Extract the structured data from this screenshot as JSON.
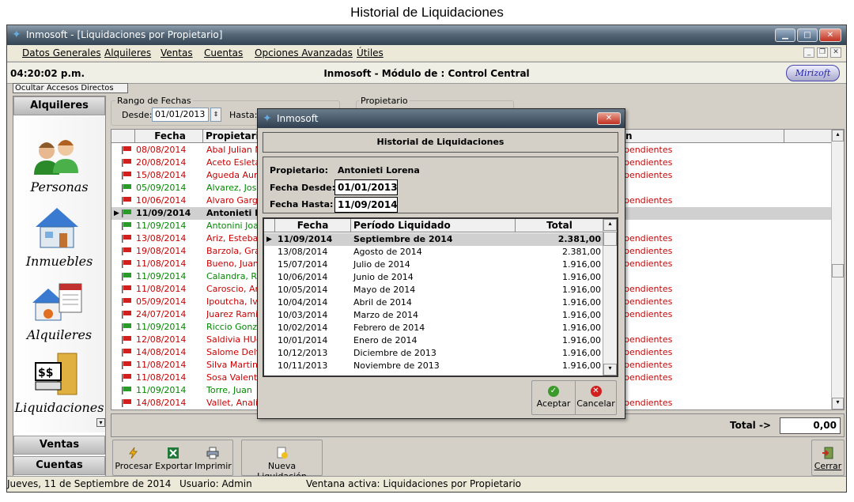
{
  "caption": "Historial de Liquidaciones",
  "window": {
    "title": "Inmosoft - [Liquidaciones por Propietario]"
  },
  "menu": [
    "Datos Generales",
    "Alquileres",
    "Ventas",
    "Cuentas",
    "Opciones Avanzadas",
    "Útiles"
  ],
  "header": {
    "clock": "04:20:02 p.m.",
    "module_title": "Inmosoft - Módulo de : Control Central",
    "logo": "Mirizoft"
  },
  "ocultar_label": "Ocultar Accesos Directos",
  "sidebar": {
    "top_header": "Alquileres",
    "items": [
      {
        "label": "Personas"
      },
      {
        "label": "Inmuebles"
      },
      {
        "label": "Alquileres"
      },
      {
        "label": "Liquidaciones"
      }
    ],
    "bottom": [
      "Ventas",
      "Cuentas"
    ]
  },
  "filters": {
    "rango_label": "Rango de Fechas",
    "desde_label": "Desde:",
    "desde_value": "01/01/2013",
    "hasta_label": "Hasta:",
    "propietario_label": "Propietario"
  },
  "grid": {
    "columns": [
      "Fecha",
      "Propietario"
    ],
    "col3_fragment": "n",
    "rows": [
      {
        "fecha": "08/08/2014",
        "prop": "Abal Julian Nic",
        "status": "red",
        "extra": "pendientes"
      },
      {
        "fecha": "20/08/2014",
        "prop": "Aceto Esleta",
        "status": "red",
        "extra": "pendientes"
      },
      {
        "fecha": "15/08/2014",
        "prop": "Agueda Auron",
        "status": "red",
        "extra": "pendientes"
      },
      {
        "fecha": "05/09/2014",
        "prop": "Alvarez, Jose",
        "status": "green",
        "extra": ""
      },
      {
        "fecha": "10/06/2014",
        "prop": "Alvaro Gargar",
        "status": "red",
        "extra": "pendientes"
      },
      {
        "fecha": "11/09/2014",
        "prop": "Antonieti  L",
        "status": "selected",
        "extra": ""
      },
      {
        "fecha": "11/09/2014",
        "prop": "Antonini Joaq",
        "status": "green",
        "extra": ""
      },
      {
        "fecha": "13/08/2014",
        "prop": "Ariz, Esteban",
        "status": "red",
        "extra": "pendientes"
      },
      {
        "fecha": "19/08/2014",
        "prop": "Barzola, Grac",
        "status": "red",
        "extra": "pendientes"
      },
      {
        "fecha": "11/08/2014",
        "prop": "Bueno, Juan F",
        "status": "red",
        "extra": "pendientes"
      },
      {
        "fecha": "11/09/2014",
        "prop": "Calandra, Rob",
        "status": "green",
        "extra": ""
      },
      {
        "fecha": "11/08/2014",
        "prop": "Caroscio, Anc",
        "status": "red",
        "extra": "pendientes"
      },
      {
        "fecha": "05/09/2014",
        "prop": "Ipoutcha, Ivar",
        "status": "red",
        "extra": "pendientes"
      },
      {
        "fecha": "24/07/2014",
        "prop": "Juarez Ramiro",
        "status": "red",
        "extra": "pendientes"
      },
      {
        "fecha": "11/09/2014",
        "prop": "Riccio Gonza",
        "status": "green",
        "extra": ""
      },
      {
        "fecha": "12/08/2014",
        "prop": "Saldivia HUgo",
        "status": "red",
        "extra": "pendientes"
      },
      {
        "fecha": "14/08/2014",
        "prop": "Salome Delfin",
        "status": "red",
        "extra": "pendientes"
      },
      {
        "fecha": "11/08/2014",
        "prop": "Silva Martin",
        "status": "red",
        "extra": "pendientes"
      },
      {
        "fecha": "11/08/2014",
        "prop": "Sosa Valentin",
        "status": "red",
        "extra": "pendientes"
      },
      {
        "fecha": "11/09/2014",
        "prop": "Torre, Juan",
        "status": "green",
        "extra": ""
      },
      {
        "fecha": "14/08/2014",
        "prop": "Vallet, Analía",
        "status": "red",
        "extra": "pendientes"
      }
    ]
  },
  "total": {
    "label": "Total ->",
    "value": "0,00"
  },
  "toolbar": {
    "procesar": "Procesar",
    "exportar": "Exportar",
    "imprimir": "Imprimir",
    "nueva": "Nueva Liquidación",
    "cerrar": "Cerrar"
  },
  "statusbar": {
    "date": "Jueves, 11 de Septiembre de 2014",
    "user": "Usuario: Admin",
    "active": "Ventana activa: Liquidaciones por Propietario"
  },
  "dialog": {
    "title": "Inmosoft",
    "heading": "Historial de Liquidaciones",
    "propietario_label": "Propietario:",
    "propietario_value": "Antonieti  Lorena",
    "desde_label": "Fecha Desde:",
    "desde_value": "01/01/2013",
    "hasta_label": "Fecha Hasta:",
    "hasta_value": "11/09/2014",
    "columns": [
      "Fecha",
      "Período Liquidado",
      "Total"
    ],
    "rows": [
      {
        "fecha": "11/09/2014",
        "periodo": "Septiembre de 2014",
        "total": "2.381,00"
      },
      {
        "fecha": "13/08/2014",
        "periodo": "Agosto de 2014",
        "total": "2.381,00"
      },
      {
        "fecha": "15/07/2014",
        "periodo": "Julio de 2014",
        "total": "1.916,00"
      },
      {
        "fecha": "10/06/2014",
        "periodo": "Junio de 2014",
        "total": "1.916,00"
      },
      {
        "fecha": "10/05/2014",
        "periodo": "Mayo de 2014",
        "total": "1.916,00"
      },
      {
        "fecha": "10/04/2014",
        "periodo": "Abril de 2014",
        "total": "1.916,00"
      },
      {
        "fecha": "10/03/2014",
        "periodo": "Marzo de 2014",
        "total": "1.916,00"
      },
      {
        "fecha": "10/02/2014",
        "periodo": "Febrero de 2014",
        "total": "1.916,00"
      },
      {
        "fecha": "10/01/2014",
        "periodo": "Enero de 2014",
        "total": "1.916,00"
      },
      {
        "fecha": "10/12/2013",
        "periodo": "Diciembre de 2013",
        "total": "1.916,00"
      },
      {
        "fecha": "10/11/2013",
        "periodo": "Noviembre de 2013",
        "total": "1.916,00"
      }
    ],
    "aceptar": "Aceptar",
    "cancelar": "Cancelar"
  }
}
